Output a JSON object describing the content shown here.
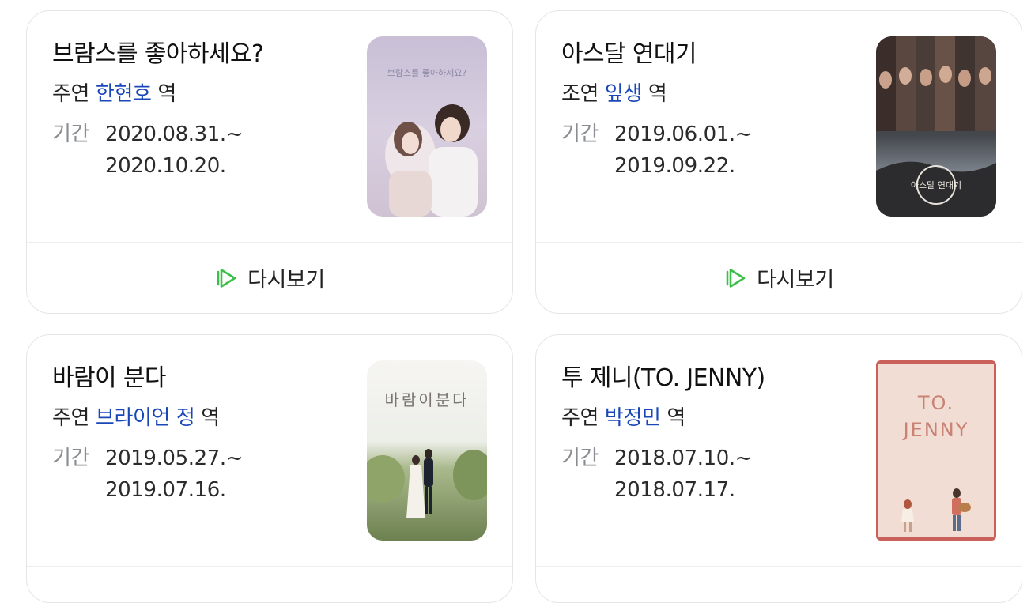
{
  "cards": [
    {
      "title": "브람스를 좋아하세요?",
      "role_type": "주연",
      "actor": "한현호",
      "role_suffix": "역",
      "period_label": "기간",
      "date_start": "2020.08.31.~",
      "date_end": "2020.10.20.",
      "poster_text": "브람스를 좋아하세요?",
      "replay_label": "다시보기"
    },
    {
      "title": "아스달 연대기",
      "role_type": "조연",
      "actor": "잎생",
      "role_suffix": "역",
      "period_label": "기간",
      "date_start": "2019.06.01.~",
      "date_end": "2019.09.22.",
      "poster_text": "아스달 연대기",
      "replay_label": "다시보기"
    },
    {
      "title": "바람이 분다",
      "role_type": "주연",
      "actor": "브라이언 정",
      "role_suffix": "역",
      "period_label": "기간",
      "date_start": "2019.05.27.~",
      "date_end": "2019.07.16.",
      "poster_text": "바람이분다"
    },
    {
      "title": "투 제니(TO. JENNY)",
      "role_type": "주연",
      "actor": "박정민",
      "role_suffix": "역",
      "period_label": "기간",
      "date_start": "2018.07.10.~",
      "date_end": "2018.07.17.",
      "poster_text_1": "TO.",
      "poster_text_2": "JENNY"
    }
  ],
  "colors": {
    "actor_link": "#1a47b8",
    "play_icon": "#3cbf49",
    "card_border": "#e3e5e8",
    "label_gray": "#8a8d91"
  },
  "icons": {
    "replay": "play-icon"
  }
}
